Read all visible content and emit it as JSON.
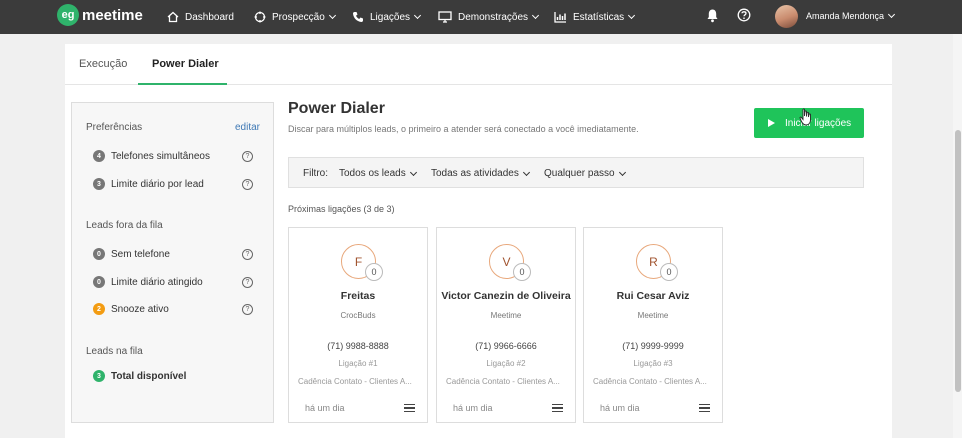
{
  "nav": {
    "logo_badge": "eg",
    "logo_text": "meetime",
    "items": [
      {
        "label": "Dashboard",
        "icon": "home-icon"
      },
      {
        "label": "Prospecção",
        "icon": "target-icon"
      },
      {
        "label": "Ligações",
        "icon": "phone-icon"
      },
      {
        "label": "Demonstrações",
        "icon": "monitor-icon"
      },
      {
        "label": "Estatísticas",
        "icon": "chart-icon"
      }
    ],
    "user_name": "Amanda Mendonça"
  },
  "tabs": [
    {
      "label": "Execução",
      "active": false
    },
    {
      "label": "Power Dialer",
      "active": true
    }
  ],
  "sidebar": {
    "preferences_heading": "Preferências",
    "edit_label": "editar",
    "preferences": [
      {
        "count": "4",
        "label": "Telefones simultâneos"
      },
      {
        "count": "3",
        "label": "Limite diário por lead"
      }
    ],
    "out_heading": "Leads fora da fila",
    "out_items": [
      {
        "count": "0",
        "label": "Sem telefone"
      },
      {
        "count": "0",
        "label": "Limite diário atingido"
      },
      {
        "count": "2",
        "label": "Snooze ativo"
      }
    ],
    "queue_heading": "Leads na fila",
    "queue_items": [
      {
        "count": "3",
        "label": "Total disponível"
      }
    ]
  },
  "main": {
    "title": "Power Dialer",
    "subtitle": "Discar para múltiplos leads, o primeiro a atender será conectado a você imediatamente.",
    "start_button": "Iniciar ligações",
    "filter": {
      "label": "Filtro:",
      "leads": "Todos os leads",
      "activities": "Todas as atividades",
      "step": "Qualquer passo"
    },
    "next_calls_label": "Próximas ligações (3 de 3)",
    "cards": [
      {
        "initial": "F",
        "count": "0",
        "name": "Freitas",
        "company": "CrocBuds",
        "phone": "(71) 9988-8888",
        "call": "Ligação #1",
        "cadence": "Cadência Contato - Clientes A...",
        "time": "há um dia"
      },
      {
        "initial": "V",
        "count": "0",
        "name": "Victor Canezin de Oliveira",
        "company": "Meetime",
        "phone": "(71) 9966-6666",
        "call": "Ligação #2",
        "cadence": "Cadência Contato - Clientes A...",
        "time": "há um dia"
      },
      {
        "initial": "R",
        "count": "0",
        "name": "Rui Cesar Aviz",
        "company": "Meetime",
        "phone": "(71) 9999-9999",
        "call": "Ligação #3",
        "cadence": "Cadência Contato - Clientes A...",
        "time": "há um dia"
      }
    ]
  },
  "colors": {
    "nav_bg": "#3b3b3b",
    "accent": "#2fb36b",
    "start_button": "#1fc45a",
    "link": "#3f79b5",
    "snooze_badge": "#f39c12"
  }
}
